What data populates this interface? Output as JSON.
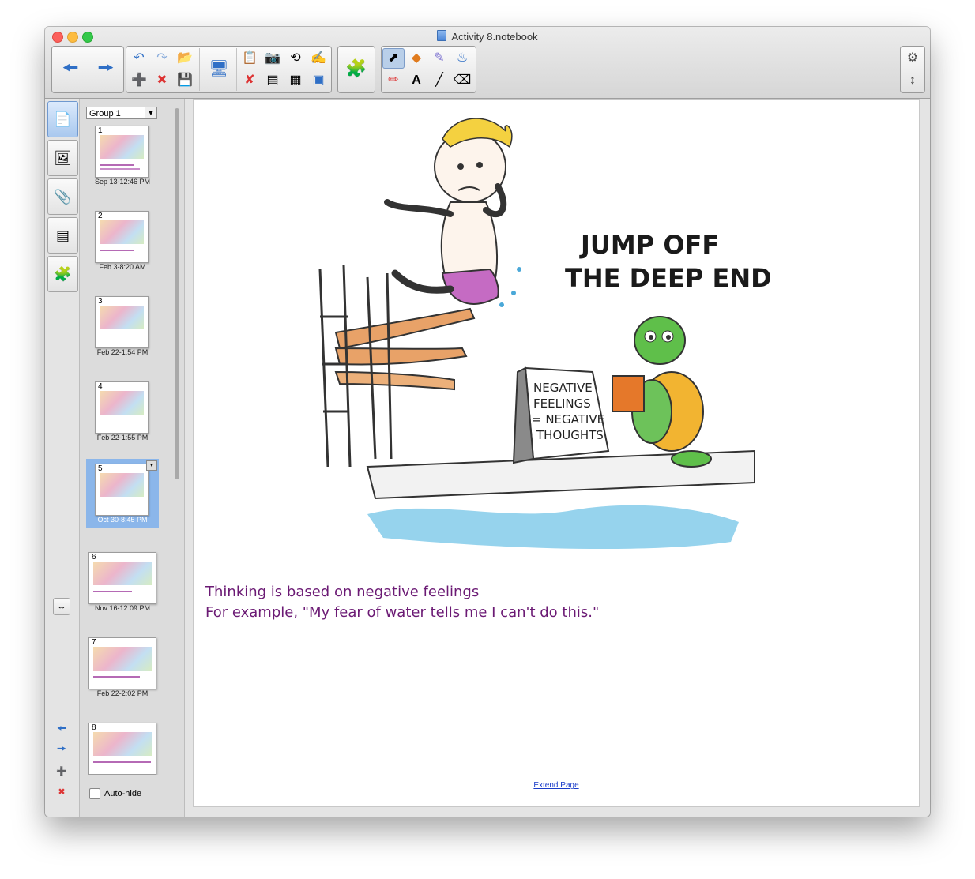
{
  "window": {
    "title": "Activity 8.notebook",
    "colors": {
      "traffic_close": "#fc605c",
      "traffic_min": "#fdbc40",
      "traffic_max": "#34c84a"
    }
  },
  "toolbar": {
    "back": "back-arrow-icon",
    "forward": "forward-arrow-icon",
    "undo": "undo-icon",
    "redo": "redo-icon",
    "open": "open-folder-icon",
    "new_page": "add-page-icon",
    "delete_page": "delete-page-icon",
    "save": "save-icon",
    "screen": "screen-display-icon",
    "paste": "paste-icon",
    "screen_capture": "camera-icon",
    "rotate": "rotate-icon",
    "recognize": "handwriting-icon",
    "delete": "delete-icon",
    "screen_shade": "screen-shade-icon",
    "table": "table-icon",
    "full_screen": "full-screen-icon",
    "addons": "puzzle-piece-icon",
    "select": "pointer-icon",
    "shapes": "shapes-icon",
    "eraser_shape": "magic-pen-icon",
    "fill": "fill-icon",
    "pens": "pens-icon",
    "text": "A",
    "line": "line-icon",
    "eraser": "eraser-icon",
    "settings": "gear-icon",
    "move_toolbar": "up-down-arrow-icon"
  },
  "side_tabs": [
    "page-sorter-icon",
    "gallery-icon",
    "attachments-icon",
    "properties-icon",
    "addons-icon"
  ],
  "sorter": {
    "group": "Group 1",
    "pages": [
      {
        "num": "1",
        "date": "Sep 13-12:46 PM"
      },
      {
        "num": "2",
        "date": "Feb 3-8:20 AM"
      },
      {
        "num": "3",
        "date": "Feb 22-1:54 PM"
      },
      {
        "num": "4",
        "date": "Feb 22-1:55 PM"
      },
      {
        "num": "5",
        "date": "Oct 30-8:45 PM"
      },
      {
        "num": "6",
        "date": "Nov 16-12:09 PM"
      },
      {
        "num": "7",
        "date": "Feb 22-2:02 PM"
      },
      {
        "num": "8",
        "date": ""
      }
    ],
    "selected_page": "5",
    "auto_hide": "Auto-hide"
  },
  "page": {
    "cartoon_title_line1": "JUMP OFF",
    "cartoon_title_line2": "THE DEEP END",
    "sign_text": [
      "NEGATIVE",
      "FEELINGS",
      "= NEGATIVE",
      "THOUGHTS"
    ],
    "caption_line1": "Thinking is based on negative feelings",
    "caption_line2": "For example, \"My fear of water tells me I can't do this.\"",
    "extend_link": "Extend Page"
  }
}
